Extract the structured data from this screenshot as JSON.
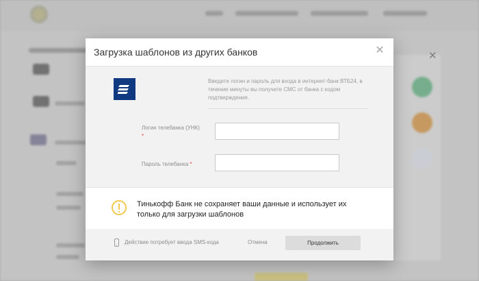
{
  "modal": {
    "title": "Загрузка шаблонов из других банков",
    "close_icon": "close-icon",
    "bank_logo_icon": "vtb24-logo",
    "info_text": "Введите логин и пароль для входа в интернет-банк ВТБ24, в течение минуты вы получите СМС от банка с кодом подтверждения.",
    "login": {
      "label": "Логин телебанка (УНК)",
      "required_mark": "*",
      "value": "",
      "placeholder": ""
    },
    "password": {
      "label": "Пароль телебанка",
      "required_mark": "*",
      "value": "",
      "placeholder": ""
    },
    "notice": {
      "icon": "warning-icon",
      "text": "Тинькофф Банк не сохраняет ваши данные и использует их только для загрузки шаблонов"
    },
    "footer": {
      "phone_icon": "phone-icon",
      "sms_note": "Действие потребует ввода SMS-кода",
      "cancel_label": "Отмена",
      "continue_label": "Продолжить"
    }
  },
  "colors": {
    "bank_logo_bg": "#0f3a82",
    "warning": "#f2c94c",
    "required": "#e23a3a",
    "continue_button_bg": "#dcdcdc"
  }
}
